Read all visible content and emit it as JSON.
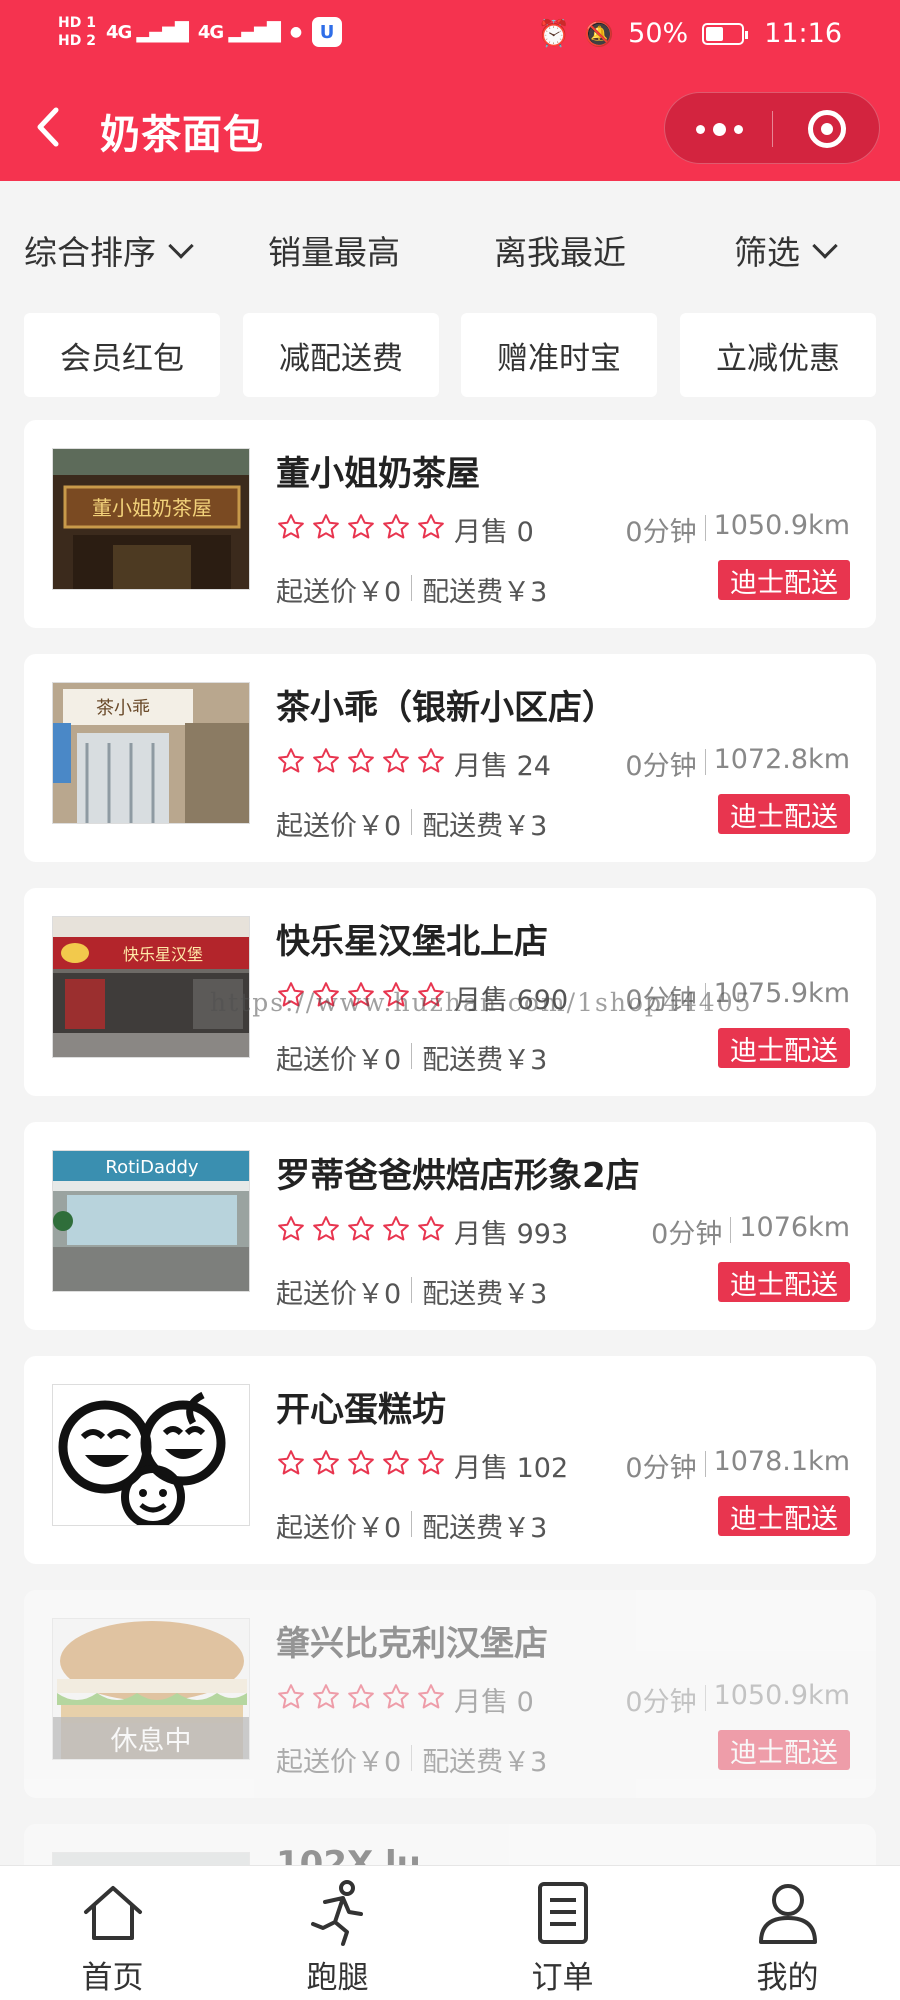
{
  "status_bar": {
    "hd_top": "HD 1",
    "hd_bottom": "HD 2",
    "signal_1": "4G",
    "signal_2": "4G",
    "battery_percent": "50%",
    "time": "11:16",
    "battery_level": 0.5
  },
  "nav": {
    "title": "奶茶面包"
  },
  "sort_bar": {
    "items": [
      "综合排序",
      "销量最高",
      "离我最近",
      "筛选"
    ]
  },
  "filter_chips": [
    "会员红包",
    "减配送费",
    "赠准时宝",
    "立减优惠"
  ],
  "shops": [
    {
      "name": "董小姐奶茶屋",
      "monthly_sales": "月售 0",
      "time": "0分钟",
      "distance": "1050.9km",
      "min_order": "起送价￥0",
      "delivery_fee": "配送费￥3",
      "delivery_tag": "迪士配送",
      "sign_text": "董小姐奶茶屋",
      "closed": false
    },
    {
      "name": "茶小乖（银新小区店）",
      "monthly_sales": "月售 24",
      "time": "0分钟",
      "distance": "1072.8km",
      "min_order": "起送价￥0",
      "delivery_fee": "配送费￥3",
      "delivery_tag": "迪士配送",
      "sign_text": "茶小乖",
      "closed": false
    },
    {
      "name": "快乐星汉堡北上店",
      "monthly_sales": "月售 690",
      "time": "0分钟",
      "distance": "1075.9km",
      "min_order": "起送价￥0",
      "delivery_fee": "配送费￥3",
      "delivery_tag": "迪士配送",
      "sign_text": "快乐星汉堡",
      "closed": false
    },
    {
      "name": "罗蒂爸爸烘焙店形象2店",
      "monthly_sales": "月售 993",
      "time": "0分钟",
      "distance": "1076km",
      "min_order": "起送价￥0",
      "delivery_fee": "配送费￥3",
      "delivery_tag": "迪士配送",
      "sign_text": "RotiDaddy",
      "closed": false
    },
    {
      "name": "开心蛋糕坊",
      "monthly_sales": "月售 102",
      "time": "0分钟",
      "distance": "1078.1km",
      "min_order": "起送价￥0",
      "delivery_fee": "配送费￥3",
      "delivery_tag": "迪士配送",
      "sign_text": "",
      "closed": false
    },
    {
      "name": "肇兴比克利汉堡店",
      "monthly_sales": "月售 0",
      "time": "0分钟",
      "distance": "1050.9km",
      "min_order": "起送价￥0",
      "delivery_fee": "配送费￥3",
      "delivery_tag": "迪士配送",
      "sign_text": "",
      "closed": true,
      "closed_label": "休息中"
    }
  ],
  "partial_shop_name": "102X lu",
  "watermark": "https://www.huzhan.com/1shop44405",
  "tab_bar": {
    "items": [
      {
        "label": "首页",
        "icon": "home-icon"
      },
      {
        "label": "跑腿",
        "icon": "runner-icon"
      },
      {
        "label": "订单",
        "icon": "order-list-icon"
      },
      {
        "label": "我的",
        "icon": "user-icon"
      }
    ]
  },
  "colors": {
    "brand": "#f5334f",
    "tag": "#e8354f",
    "star_outline": "#e8354f",
    "background": "#f4f4f4"
  }
}
